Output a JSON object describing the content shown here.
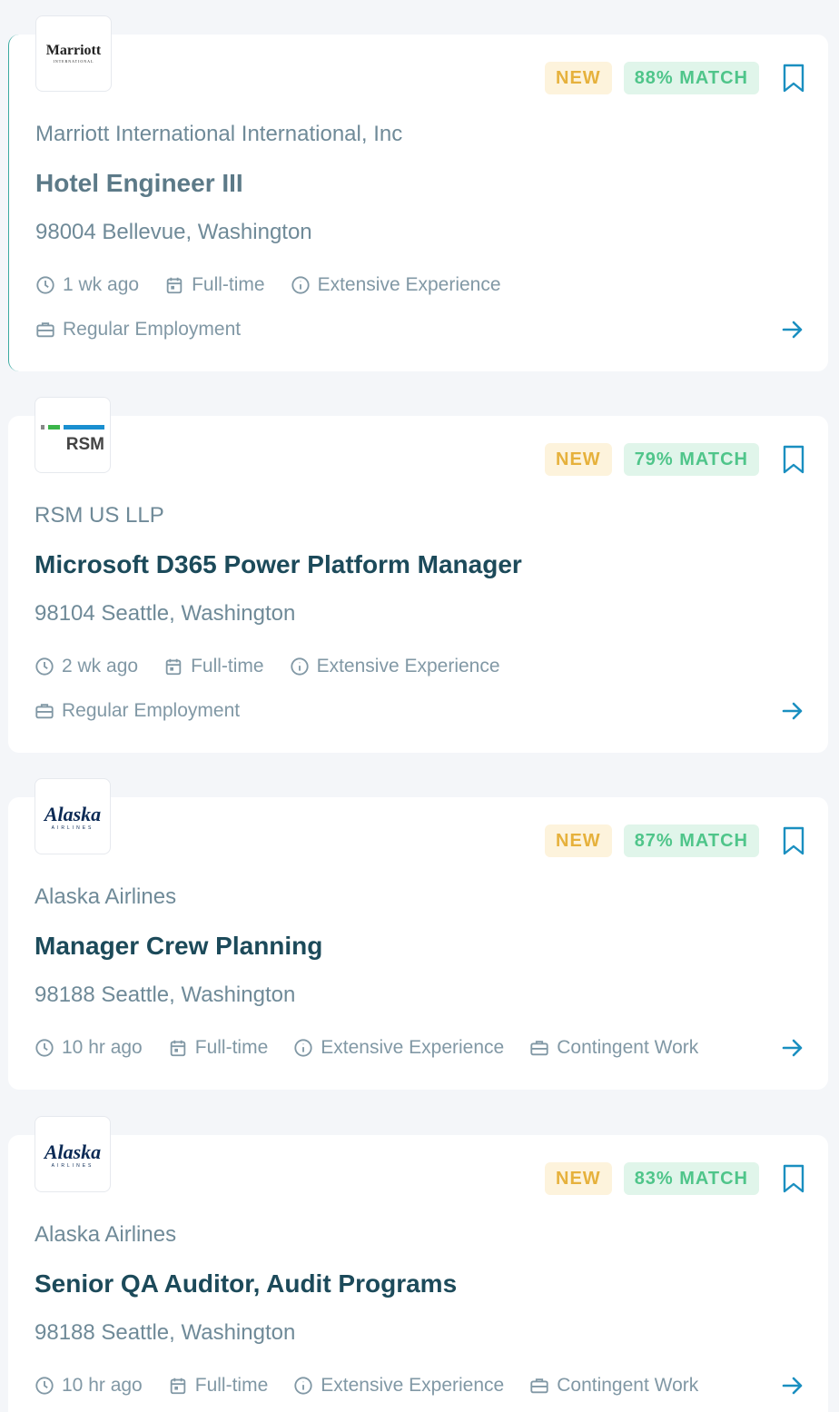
{
  "colors": {
    "accent": "#1a8fc0",
    "new_badge": "#e6b13c",
    "match_badge": "#4fc58a"
  },
  "jobs": [
    {
      "logo": {
        "kind": "marriott",
        "text": "Marriott",
        "sub": "INTERNATIONAL"
      },
      "new_label": "NEW",
      "match_label": "88% MATCH",
      "company": "Marriott International International, Inc",
      "title": "Hotel Engineer III",
      "location": "98004 Bellevue, Washington",
      "posted": "1 wk ago",
      "schedule": "Full-time",
      "experience": "Extensive Experience",
      "employment": "Regular Employment"
    },
    {
      "logo": {
        "kind": "rsm",
        "text": "RSM"
      },
      "new_label": "NEW",
      "match_label": "79% MATCH",
      "company": "RSM US LLP",
      "title": "Microsoft D365 Power Platform Manager",
      "location": "98104 Seattle, Washington",
      "posted": "2 wk ago",
      "schedule": "Full-time",
      "experience": "Extensive Experience",
      "employment": "Regular Employment"
    },
    {
      "logo": {
        "kind": "alaska",
        "text": "Alaska",
        "sub": "AIRLINES"
      },
      "new_label": "NEW",
      "match_label": "87% MATCH",
      "company": "Alaska Airlines",
      "title": "Manager Crew Planning",
      "location": "98188 Seattle, Washington",
      "posted": "10 hr ago",
      "schedule": "Full-time",
      "experience": "Extensive Experience",
      "employment": "Contingent Work"
    },
    {
      "logo": {
        "kind": "alaska",
        "text": "Alaska",
        "sub": "AIRLINES"
      },
      "new_label": "NEW",
      "match_label": "83% MATCH",
      "company": "Alaska Airlines",
      "title": "Senior QA Auditor, Audit Programs",
      "location": "98188 Seattle, Washington",
      "posted": "10 hr ago",
      "schedule": "Full-time",
      "experience": "Extensive Experience",
      "employment": "Contingent Work"
    }
  ]
}
